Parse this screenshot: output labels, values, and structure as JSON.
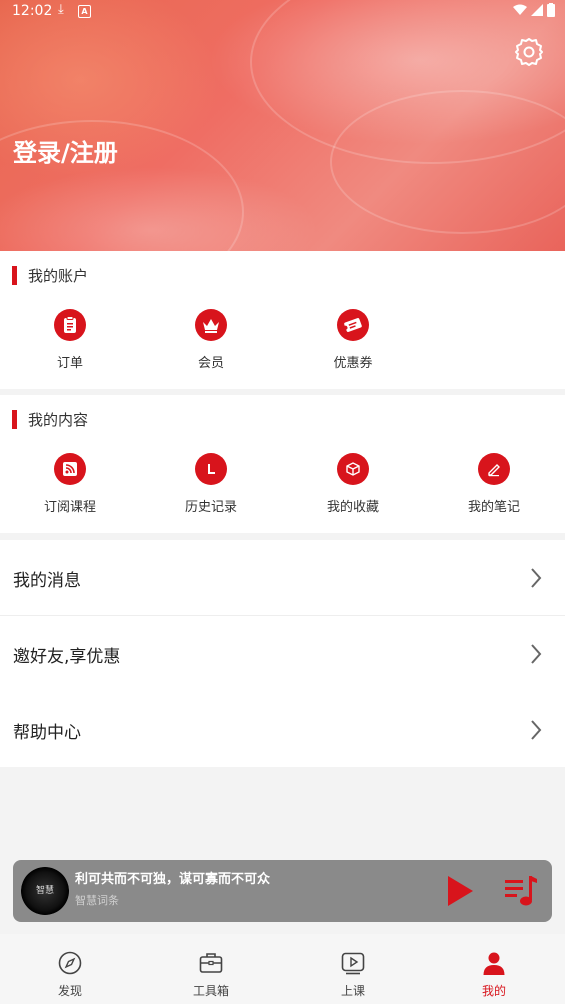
{
  "status_bar": {
    "time": "12:02"
  },
  "header": {
    "login_label": "登录/注册"
  },
  "account_section": {
    "title": "我的账户",
    "items": [
      {
        "label": "订单",
        "icon": "clipboard-icon"
      },
      {
        "label": "会员",
        "icon": "crown-icon"
      },
      {
        "label": "优惠券",
        "icon": "ticket-icon"
      }
    ]
  },
  "content_section": {
    "title": "我的内容",
    "items": [
      {
        "label": "订阅课程",
        "icon": "rss-icon"
      },
      {
        "label": "历史记录",
        "icon": "history-icon"
      },
      {
        "label": "我的收藏",
        "icon": "box-icon"
      },
      {
        "label": "我的笔记",
        "icon": "pencil-icon"
      }
    ]
  },
  "menu": {
    "items": [
      {
        "label": "我的消息"
      },
      {
        "label": "邀好友,享优惠"
      },
      {
        "label": "帮助中心"
      }
    ]
  },
  "player": {
    "title": "利可共而不可独，谋可寡而不可众",
    "subtitle": "智慧词条"
  },
  "bottom_nav": {
    "items": [
      {
        "label": "发现",
        "icon": "compass-icon"
      },
      {
        "label": "工具箱",
        "icon": "toolbox-icon"
      },
      {
        "label": "上课",
        "icon": "video-icon"
      },
      {
        "label": "我的",
        "icon": "user-icon"
      }
    ],
    "active_index": 3
  },
  "colors": {
    "accent": "#d8141c",
    "player_bg": "#8a8a8a"
  }
}
